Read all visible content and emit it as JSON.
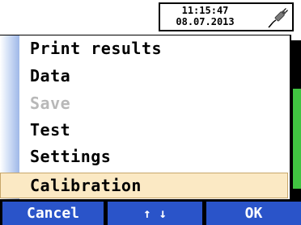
{
  "status": {
    "time": "11:15:47",
    "date": "08.07.2013",
    "power_icon": "plug-icon"
  },
  "menu": {
    "items": [
      {
        "label": "Print results",
        "state": "normal"
      },
      {
        "label": "Data",
        "state": "normal"
      },
      {
        "label": "Save",
        "state": "disabled"
      },
      {
        "label": "Test",
        "state": "normal"
      },
      {
        "label": "Settings",
        "state": "normal"
      },
      {
        "label": "Calibration",
        "state": "selected"
      }
    ]
  },
  "softkeys": {
    "left_label": "Cancel",
    "middle_label": "↑ ↓",
    "right_label": "OK"
  },
  "colors": {
    "softkey_bg": "#2a54c9",
    "selected_bg": "#fbe9c4",
    "side_indicator": "#41c441",
    "disabled_text": "#b8b8b8"
  }
}
